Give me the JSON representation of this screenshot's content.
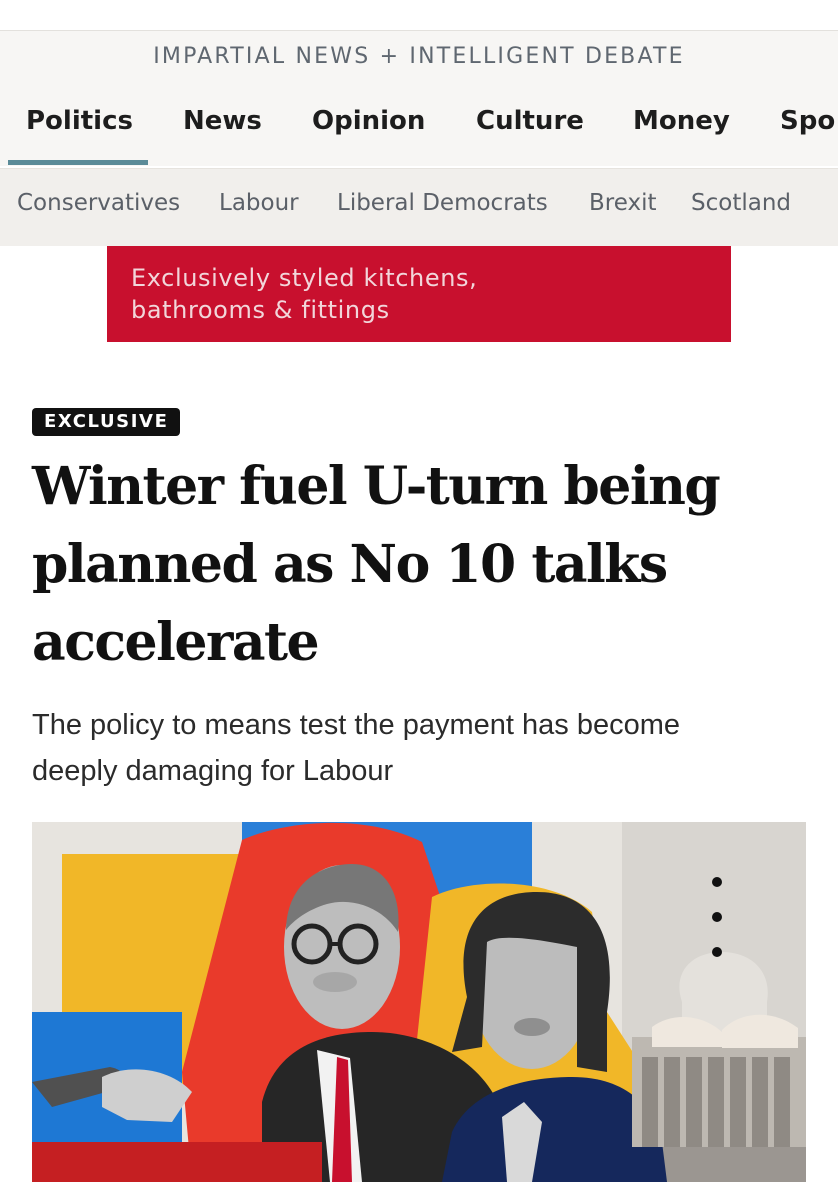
{
  "header": {
    "tagline": "IMPARTIAL NEWS + INTELLIGENT DEBATE"
  },
  "nav": {
    "items": [
      "Politics",
      "News",
      "Opinion",
      "Culture",
      "Money",
      "Spo"
    ],
    "active": "Politics"
  },
  "subnav": {
    "items": [
      "Conservatives",
      "Labour",
      "Liberal Democrats",
      "Brexit",
      "Scotland"
    ]
  },
  "ad": {
    "line1": "Exclusively styled kitchens,",
    "line2": "bathrooms & fittings",
    "color": "#c8102e"
  },
  "article": {
    "badge": "EXCLUSIVE",
    "headline_lines": [
      "Winter fuel U-turn being",
      "planned as No 10 talks",
      "accelerate"
    ],
    "standfirst_lines": [
      "The policy to means test the payment has become",
      "deeply damaging for Labour"
    ]
  },
  "colors": {
    "accent": "#5b8b98",
    "badge_bg": "#111111"
  }
}
